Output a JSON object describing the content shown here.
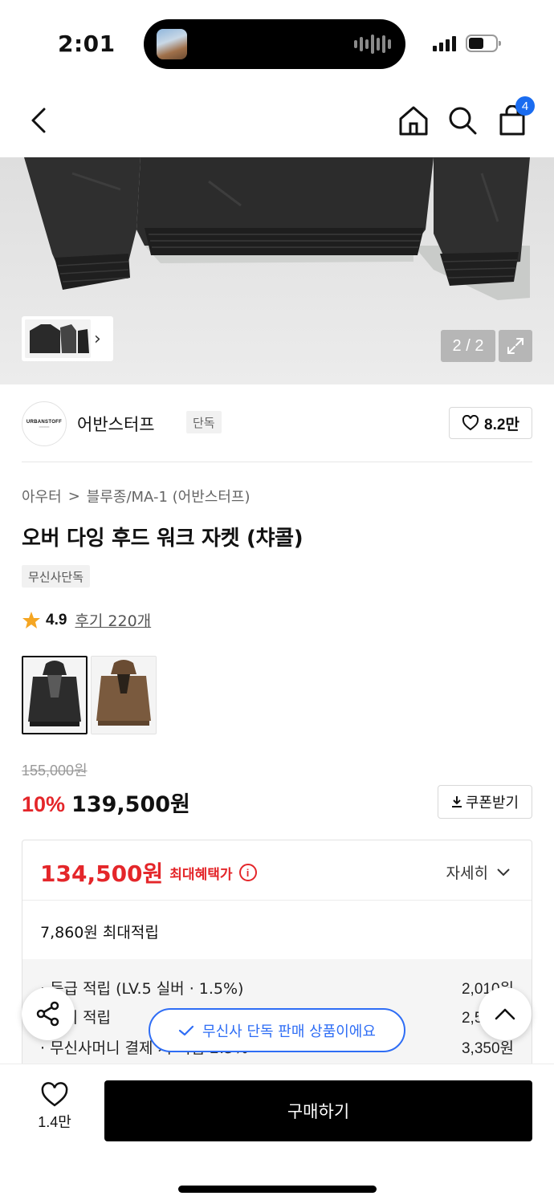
{
  "status_bar": {
    "time": "2:01"
  },
  "nav": {
    "cart_count": "4"
  },
  "hero": {
    "page_counter": "2 / 2"
  },
  "brand": {
    "logo_text": "URBANSTOFF",
    "name": "어반스터프",
    "tag": "단독",
    "like_count": "8.2만"
  },
  "breadcrumb": {
    "category": "아우터",
    "separator": ">",
    "subcategory": "블루종/MA-1 (어반스터프)"
  },
  "product": {
    "title": "오버 다잉 후드 워크 자켓 (챠콜)",
    "exclusive_tag": "무신사단독",
    "rating": "4.9",
    "review_link": "후기 220개"
  },
  "swatches": [
    {
      "color_name": "charcoal",
      "selected": true
    },
    {
      "color_name": "brown",
      "selected": false
    }
  ],
  "pricing": {
    "original_price": "155,000원",
    "discount": "10%",
    "sale_price": "139,500원",
    "coupon_label": "쿠폰받기"
  },
  "benefit": {
    "max_benefit_price": "134,500원",
    "max_benefit_label": "최대혜택가",
    "detail_label": "자세히",
    "max_point": "7,860원 최대적립",
    "points": [
      {
        "label": "· 등급 적립 (LV.5 실버 · 1.5%)",
        "amount": "2,010원"
      },
      {
        "label": "· 후기 적립",
        "amount": "2,500원"
      },
      {
        "label": "· 무신사머니 결제 시 적립 2.5%",
        "amount": "3,350원"
      }
    ]
  },
  "toast": {
    "text": "무신사 단독 판매 상품이에요"
  },
  "bottom_bar": {
    "like_count": "1.4만",
    "buy_label": "구매하기"
  },
  "colors": {
    "accent_red": "#e4262a",
    "accent_blue": "#2e6df5",
    "badge_blue": "#1a6cf0"
  }
}
